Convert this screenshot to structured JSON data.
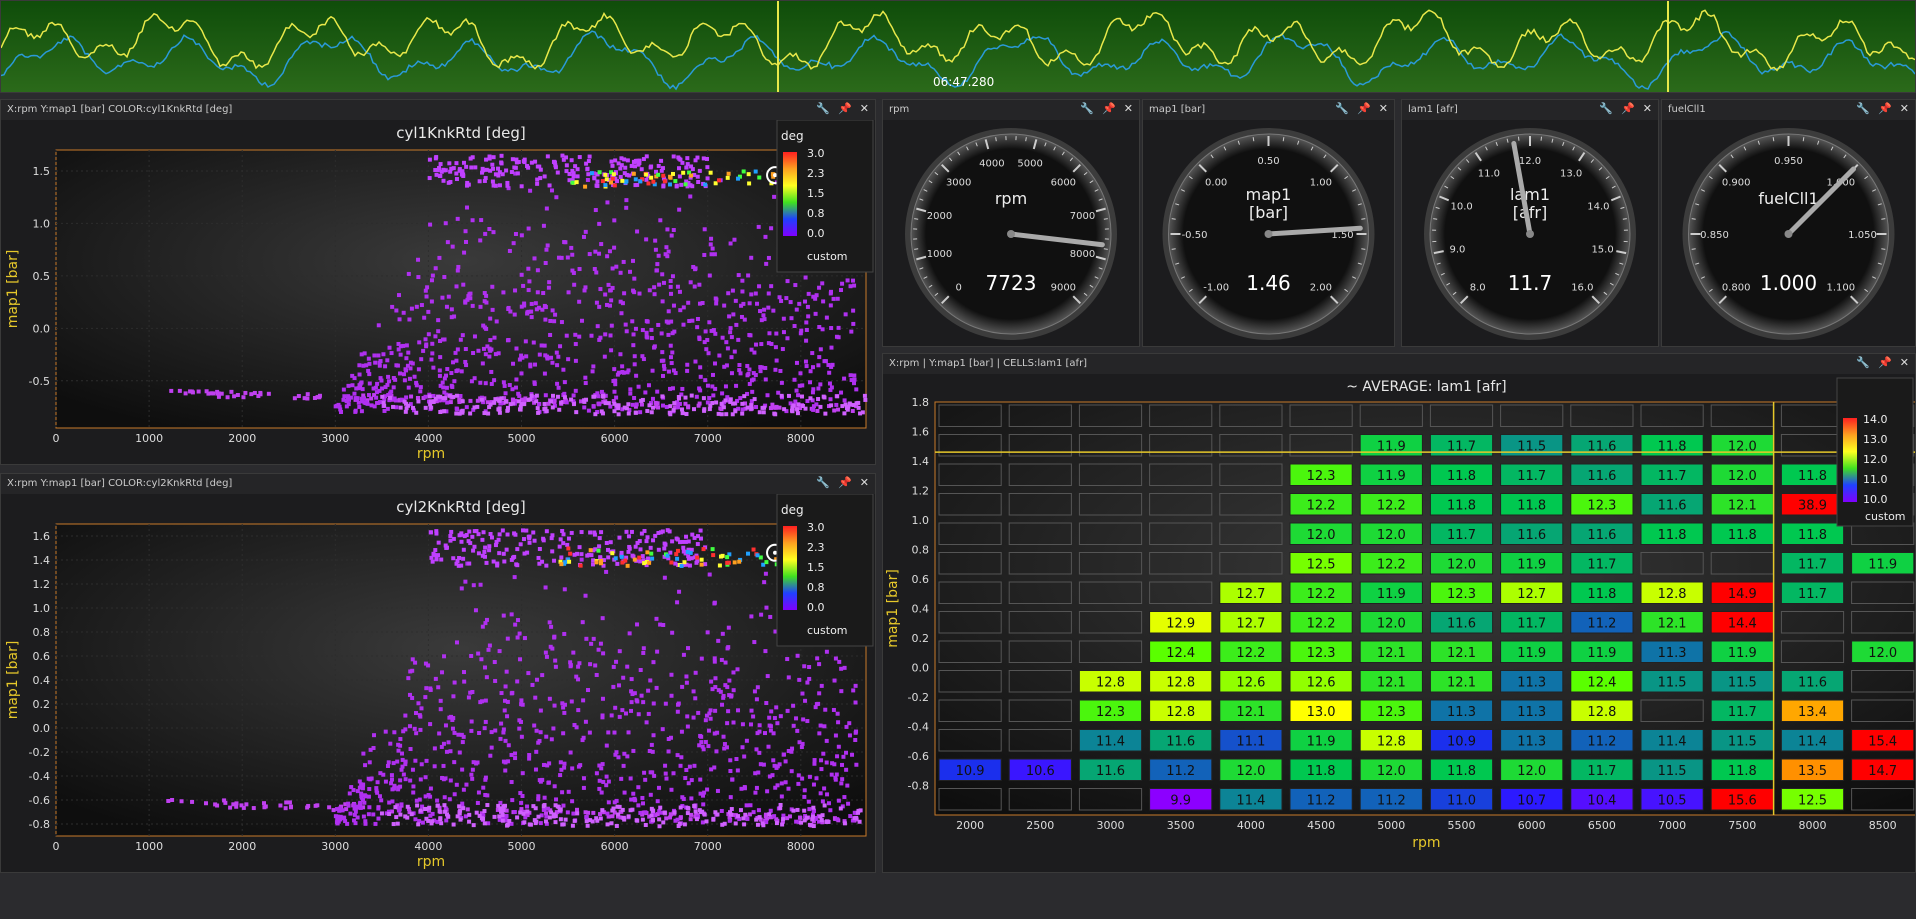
{
  "timeline": {
    "timestamp": "06:47.280",
    "colors": {
      "bg": "#1f5a12",
      "trace1": "#e8e84a",
      "trace2": "#2a9ad8",
      "cursor": "#e8e84a"
    }
  },
  "tools": {
    "wrench": "wrench-icon",
    "pin": "pin-icon",
    "close": "close-icon"
  },
  "scatter_panels": [
    {
      "header": "X:rpm   Y:map1 [bar]   COLOR:cyl1KnkRtd [deg]",
      "title": "cyl1KnkRtd [deg]"
    },
    {
      "header": "X:rpm   Y:map1 [bar]   COLOR:cyl2KnkRtd [deg]",
      "title": "cyl2KnkRtd [deg]"
    }
  ],
  "gauges": [
    {
      "header": "rpm",
      "label": "rpm",
      "value": "7723"
    },
    {
      "header": "map1 [bar]",
      "label": "map1\n[bar]",
      "value": "1.46"
    },
    {
      "header": "lam1 [afr]",
      "label": "lam1\n[afr]",
      "value": "11.7"
    },
    {
      "header": "fuelCll1",
      "label": "fuelCll1",
      "value": "1.000"
    }
  ],
  "table_panel": {
    "header": "X:rpm | Y:map1 [bar] | CELLS:lam1 [afr]",
    "legend": {
      "title": "",
      "ticks": [
        "14.0",
        "13.0",
        "12.0",
        "11.0",
        "10.0"
      ],
      "footer": "custom"
    }
  },
  "chart_data": [
    {
      "type": "scatter",
      "title": "cyl1KnkRtd [deg]",
      "xlabel": "rpm",
      "ylabel": "map1 [bar]",
      "xlim": [
        0,
        8700
      ],
      "ylim": [
        -0.95,
        1.7
      ],
      "x_ticks": [
        "0",
        "1000",
        "2000",
        "3000",
        "4000",
        "5000",
        "6000",
        "7000",
        "8000"
      ],
      "y_ticks": [
        "1.5",
        "1.0",
        "0.5",
        "0.0",
        "-0.5"
      ],
      "legend": {
        "title": "deg",
        "ticks": [
          "3.0",
          "2.3",
          "1.5",
          "0.8",
          "0.0"
        ],
        "footer": "custom"
      }
    },
    {
      "type": "scatter",
      "title": "cyl2KnkRtd [deg]",
      "xlabel": "rpm",
      "ylabel": "map1 [bar]",
      "xlim": [
        0,
        8700
      ],
      "ylim": [
        -0.9,
        1.7
      ],
      "x_ticks": [
        "0",
        "1000",
        "2000",
        "3000",
        "4000",
        "5000",
        "6000",
        "7000",
        "8000"
      ],
      "y_ticks": [
        "1.6",
        "1.4",
        "1.2",
        "1.0",
        "0.8",
        "0.6",
        "0.4",
        "0.2",
        "0.0",
        "-0.2",
        "-0.4",
        "-0.6",
        "-0.8"
      ],
      "legend": {
        "title": "deg",
        "ticks": [
          "3.0",
          "2.3",
          "1.5",
          "0.8",
          "0.0"
        ],
        "footer": "custom"
      }
    },
    {
      "type": "heatmap",
      "title": "~ AVERAGE: lam1 [afr]",
      "xlabel": "rpm",
      "ylabel": "map1 [bar]",
      "x": [
        "2000",
        "2500",
        "3000",
        "3500",
        "4000",
        "4500",
        "5000",
        "5500",
        "6000",
        "6500",
        "7000",
        "7500",
        "8000",
        "8500"
      ],
      "y": [
        "1.8",
        "1.6",
        "1.4",
        "1.2",
        "1.0",
        "0.8",
        "0.6",
        "0.4",
        "0.2",
        "0.0",
        "-0.2",
        "-0.4",
        "-0.6",
        "-0.8"
      ],
      "values": [
        [
          null,
          null,
          null,
          null,
          null,
          null,
          null,
          null,
          null,
          null,
          null,
          null,
          null,
          null
        ],
        [
          null,
          null,
          null,
          null,
          null,
          null,
          11.9,
          11.7,
          11.5,
          11.6,
          11.8,
          12.0,
          null,
          null
        ],
        [
          null,
          null,
          null,
          null,
          null,
          12.3,
          11.9,
          11.8,
          11.7,
          11.6,
          11.7,
          12.0,
          11.8,
          null
        ],
        [
          null,
          null,
          null,
          null,
          null,
          12.2,
          12.2,
          11.8,
          11.8,
          12.3,
          11.6,
          12.1,
          38.9,
          null
        ],
        [
          null,
          null,
          null,
          null,
          null,
          12.0,
          12.0,
          11.7,
          11.6,
          11.6,
          11.8,
          11.8,
          11.8,
          null
        ],
        [
          null,
          null,
          null,
          null,
          null,
          12.5,
          12.2,
          12.0,
          11.9,
          11.7,
          null,
          null,
          11.7,
          11.9
        ],
        [
          null,
          null,
          null,
          null,
          12.7,
          12.2,
          11.9,
          12.3,
          12.7,
          11.8,
          12.8,
          14.9,
          11.7,
          null
        ],
        [
          null,
          null,
          null,
          12.9,
          12.7,
          12.2,
          12.0,
          11.6,
          11.7,
          11.2,
          12.1,
          14.4,
          null,
          null
        ],
        [
          null,
          null,
          null,
          12.4,
          12.2,
          12.3,
          12.1,
          12.1,
          11.9,
          11.9,
          11.3,
          11.9,
          null,
          12.0
        ],
        [
          null,
          null,
          12.8,
          12.8,
          12.6,
          12.6,
          12.1,
          12.1,
          11.3,
          12.4,
          11.5,
          11.5,
          11.6,
          null
        ],
        [
          null,
          null,
          12.3,
          12.8,
          12.1,
          13.0,
          12.3,
          11.3,
          11.3,
          12.8,
          null,
          11.7,
          13.4,
          null
        ],
        [
          null,
          null,
          11.4,
          11.6,
          11.1,
          11.9,
          12.8,
          10.9,
          11.3,
          11.2,
          11.4,
          11.5,
          11.4,
          15.4
        ],
        [
          10.9,
          10.6,
          11.6,
          11.2,
          12.0,
          11.8,
          12.0,
          11.8,
          12.0,
          11.7,
          11.5,
          11.8,
          13.5,
          14.7
        ],
        [
          null,
          null,
          null,
          9.9,
          11.4,
          11.2,
          11.2,
          11.0,
          10.7,
          10.4,
          10.5,
          15.6,
          12.5,
          null
        ]
      ],
      "cursor": {
        "x_rpm": 7723,
        "y_map1": 1.46
      }
    }
  ]
}
